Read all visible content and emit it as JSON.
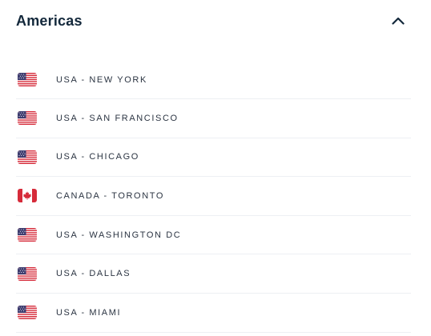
{
  "section": {
    "title": "Americas",
    "expanded": true,
    "toggle_icon": "chevron-up-icon"
  },
  "locations": [
    {
      "label": "USA - NEW YORK",
      "flag": "us-flag-icon"
    },
    {
      "label": "USA - SAN FRANCISCO",
      "flag": "us-flag-icon"
    },
    {
      "label": "USA - CHICAGO",
      "flag": "us-flag-icon"
    },
    {
      "label": "CANADA - TORONTO",
      "flag": "canada-flag-icon"
    },
    {
      "label": "USA - WASHINGTON DC",
      "flag": "us-flag-icon"
    },
    {
      "label": "USA - DALLAS",
      "flag": "us-flag-icon"
    },
    {
      "label": "USA - MIAMI",
      "flag": "us-flag-icon"
    }
  ],
  "colors": {
    "title": "#13283b",
    "text": "#2b3442",
    "divider": "#edf0f3",
    "flag_red": "#d62b3a",
    "flag_blue": "#3c3b6e",
    "flag_white": "#ffffff"
  }
}
